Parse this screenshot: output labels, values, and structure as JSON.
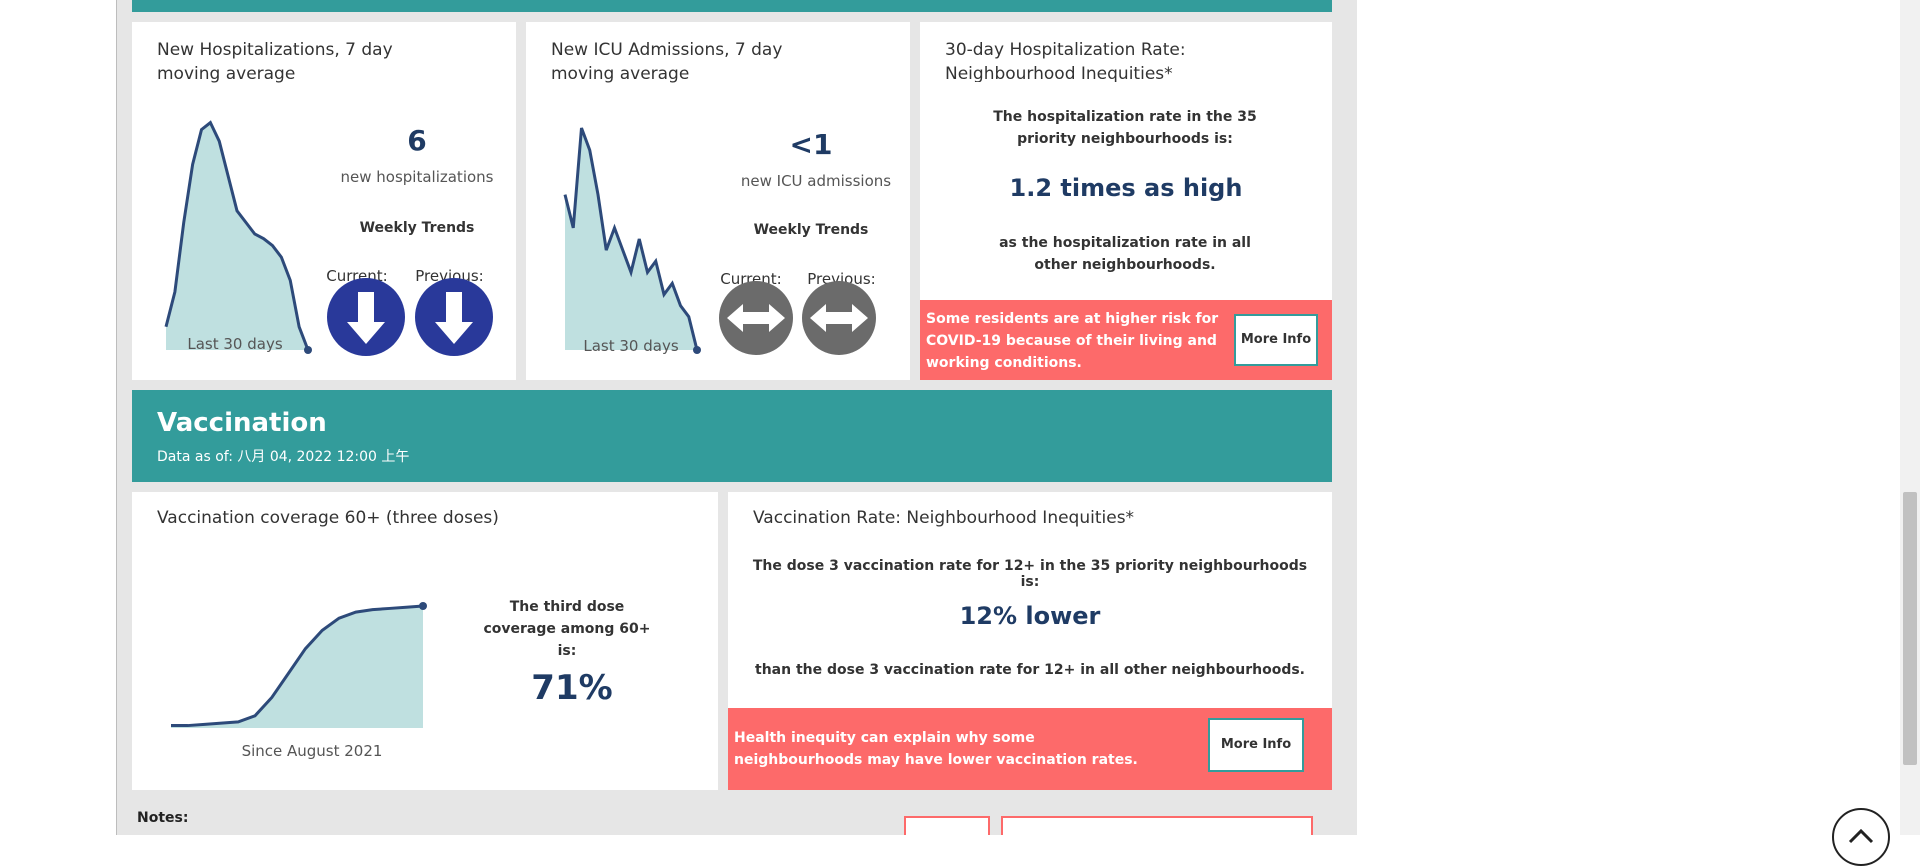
{
  "hospital": {
    "card1": {
      "title": "New Hospitalizations, 7 day moving average",
      "value": "6",
      "value_label": "new hospitalizations",
      "trends_label": "Weekly Trends",
      "current_label": "Current:",
      "previous_label": "Previous:",
      "current_trend": "arrow-down-icon",
      "previous_trend": "arrow-down-icon",
      "chart_label": "Last 30 days",
      "sparkline": [
        0.1,
        0.25,
        0.55,
        0.8,
        0.95,
        0.98,
        0.9,
        0.75,
        0.6,
        0.55,
        0.5,
        0.48,
        0.45,
        0.4,
        0.3,
        0.1,
        0.0
      ]
    },
    "card2": {
      "title": "New ICU Admissions, 7 day moving average",
      "value": "<1",
      "value_label": "new ICU admissions",
      "trends_label": "Weekly Trends",
      "current_label": "Current:",
      "previous_label": "Previous:",
      "current_trend": "arrow-left-right-icon",
      "previous_trend": "arrow-left-right-icon",
      "chart_label": "Last 30 days",
      "sparkline": [
        0.7,
        0.55,
        1.0,
        0.9,
        0.7,
        0.45,
        0.55,
        0.45,
        0.35,
        0.5,
        0.35,
        0.4,
        0.25,
        0.3,
        0.2,
        0.15,
        0.0
      ]
    },
    "card3": {
      "title": "30-day Hospitalization Rate: Neighbourhood Inequities*",
      "intro": "The hospitalization rate in the 35 priority neighbourhoods is:",
      "value": "1.2 times as high",
      "outro": "as the hospitalization rate in all other neighbourhoods.",
      "banner_text": "Some residents are at higher risk for COVID-19 because of their living and working conditions.",
      "button_label": "More Info"
    }
  },
  "vaccination": {
    "section_title": "Vaccination",
    "data_as_of": "Data as of: 八月 04, 2022 12:00 上午",
    "coverage_card": {
      "title": "Vaccination coverage 60+ (three doses)",
      "chart_label": "Since August 2021",
      "coverage_text": "The third dose coverage among 60+ is:",
      "value": "71%",
      "curve": [
        0.02,
        0.02,
        0.03,
        0.04,
        0.05,
        0.1,
        0.25,
        0.45,
        0.65,
        0.8,
        0.9,
        0.95,
        0.97,
        0.98,
        0.99,
        1.0
      ]
    },
    "rate_card": {
      "title": "Vaccination Rate: Neighbourhood Inequities*",
      "intro": "The dose 3 vaccination rate for 12+ in the 35 priority neighbourhoods is:",
      "value": "12% lower",
      "outro": "than the dose 3 vaccination rate for 12+ in all other neighbourhoods.",
      "banner_text": "Health inequity can explain why some neighbourhoods may have lower vaccination rates.",
      "button_label": "More Info"
    }
  },
  "notes_label": "Notes:",
  "colors": {
    "teal": "#339c9b",
    "navy": "#1f3b64",
    "coral": "#fd6a6a",
    "sparkfill": "#bfe0e0",
    "sparkline": "#2d4a7a"
  }
}
